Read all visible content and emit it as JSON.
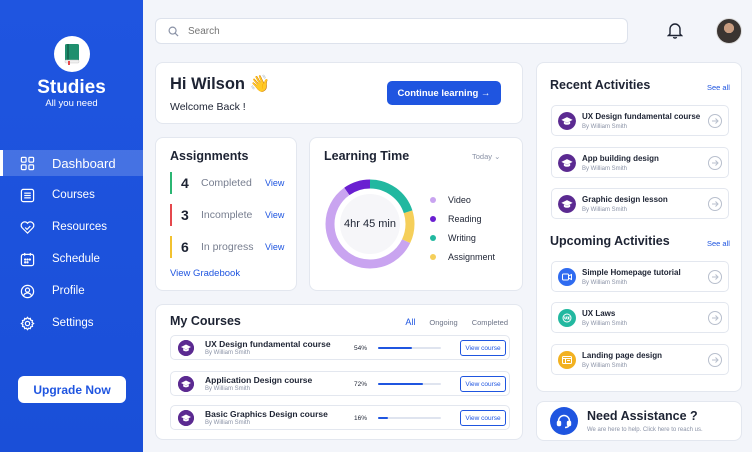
{
  "sidebar": {
    "app_title": "Studies",
    "app_subtitle": "All you need",
    "items": [
      {
        "label": "Dashboard",
        "icon": "grid-icon"
      },
      {
        "label": "Courses",
        "icon": "list-icon"
      },
      {
        "label": "Resources",
        "icon": "heart-check-icon"
      },
      {
        "label": "Schedule",
        "icon": "calendar-icon"
      },
      {
        "label": "Profile",
        "icon": "user-icon"
      },
      {
        "label": "Settings",
        "icon": "gear-icon"
      }
    ],
    "upgrade_label": "Upgrade Now"
  },
  "header": {
    "search_placeholder": "Search"
  },
  "welcome": {
    "greeting": "Hi Wilson 👋",
    "subtitle": "Welcome Back !",
    "continue_label": "Continue learning →"
  },
  "assignments": {
    "title": "Assignments",
    "rows": [
      {
        "count": "4",
        "label": "Completed",
        "color": "#2bb673",
        "view": "View"
      },
      {
        "count": "3",
        "label": "Incomplete",
        "color": "#e5484d",
        "view": "View"
      },
      {
        "count": "6",
        "label": "In progress",
        "color": "#f2c230",
        "view": "View"
      }
    ],
    "gradebook_label": "View Gradebook"
  },
  "learning_time": {
    "title": "Learning Time",
    "period": "Today ⌄",
    "total": "4hr 45 min",
    "segments": [
      {
        "name": "Video",
        "value": 0.58,
        "color": "#c9a4f0"
      },
      {
        "name": "Reading",
        "value": 0.1,
        "color": "#6a1fd1"
      },
      {
        "name": "Writing",
        "value": 0.2,
        "color": "#22b8a0"
      },
      {
        "name": "Assignment",
        "value": 0.12,
        "color": "#f5cf5a"
      }
    ]
  },
  "my_courses": {
    "title": "My Courses",
    "tabs": [
      "All",
      "Ongoing",
      "Completed"
    ],
    "rows": [
      {
        "title": "UX Design fundamental course",
        "by": "By William Smith",
        "percent_label": "54%",
        "progress": 0.54,
        "button": "View course"
      },
      {
        "title": "Application Design course",
        "by": "By William Smith",
        "percent_label": "72%",
        "progress": 0.72,
        "button": "View course"
      },
      {
        "title": "Basic Graphics Design course",
        "by": "By William Smith",
        "percent_label": "16%",
        "progress": 0.16,
        "button": "View course"
      }
    ]
  },
  "recent": {
    "title": "Recent Activities",
    "see_all": "See all",
    "items": [
      {
        "title": "UX Design fundamental course",
        "by": "By William Smith"
      },
      {
        "title": "App building design",
        "by": "By William Smith"
      },
      {
        "title": "Graphic design lesson",
        "by": "By William Smith"
      }
    ]
  },
  "upcoming": {
    "title": "Upcoming Activities",
    "see_all": "See all",
    "items": [
      {
        "title": "Simple Homepage tutorial",
        "by": "By William Smith",
        "color": "#2f6bf0",
        "icon": "video-icon"
      },
      {
        "title": "UX Laws",
        "by": "By William Smith",
        "color": "#22b8a0",
        "icon": "ux-badge-icon"
      },
      {
        "title": "Landing page design",
        "by": "By William Smith",
        "color": "#f2b120",
        "icon": "layout-icon"
      }
    ]
  },
  "assistance": {
    "title": "Need Assistance ?",
    "subtitle": "We are here to help. Click here to reach us."
  }
}
